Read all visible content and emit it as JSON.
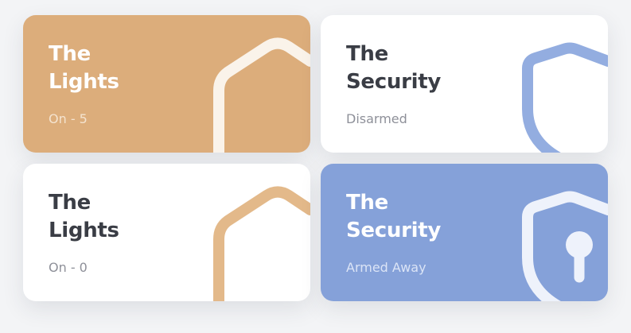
{
  "cards": [
    {
      "title_line1": "The",
      "title_line2": "Lights",
      "status": "On - 5"
    },
    {
      "title_line1": "The",
      "title_line2": "Security",
      "status": "Disarmed"
    },
    {
      "title_line1": "The",
      "title_line2": "Lights",
      "status": "On - 0"
    },
    {
      "title_line1": "The",
      "title_line2": "Security",
      "status": "Armed Away"
    }
  ],
  "colors": {
    "lights_on": "#dcad7b",
    "lights_icon_off": "#e3b98a",
    "security_armed": "#85a1d9",
    "security_icon_disarmed": "#93ade0",
    "card_white": "#ffffff",
    "text_dark": "#3a3d45",
    "text_muted": "#8e9099"
  },
  "icons": {
    "lights": "house-icon",
    "security_disarmed": "shield-icon",
    "security_armed": "shield-lock-icon"
  }
}
